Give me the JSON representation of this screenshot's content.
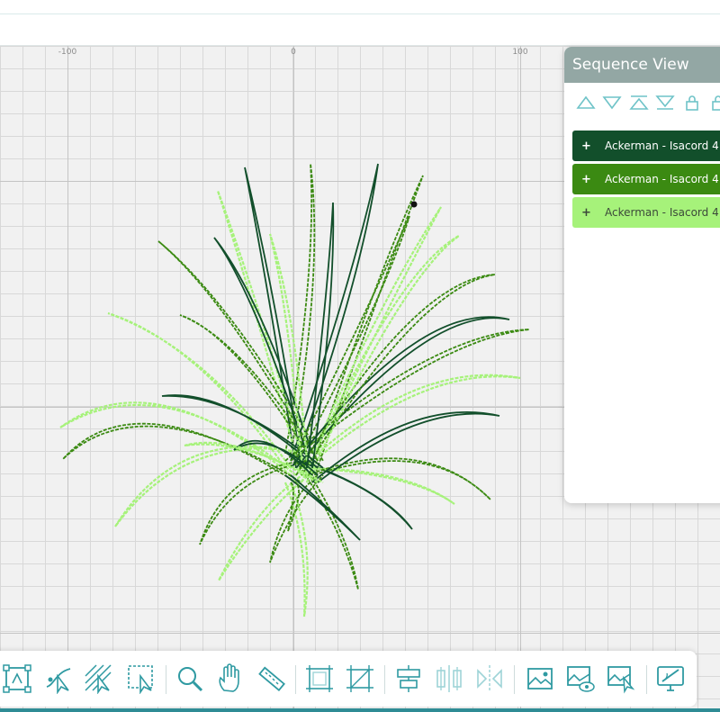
{
  "ruler": {
    "labels": [
      "-100",
      "0",
      "100"
    ]
  },
  "sequence_view": {
    "title": "Sequence View",
    "tools": [
      "move-up-icon",
      "move-down-icon",
      "move-to-top-icon",
      "move-to-bottom-icon",
      "lock-icon",
      "unlock-icon"
    ],
    "items": [
      {
        "plus": "+",
        "label": "Ackerman - Isacord 4",
        "color": "#124f2b"
      },
      {
        "plus": "+",
        "label": "Ackerman - Isacord 4",
        "color": "#3b8a12"
      },
      {
        "plus": "+",
        "label": "Ackerman - Isacord 4",
        "color": "#a6f27a"
      }
    ]
  },
  "toolbar": {
    "tools": [
      "transform-icon",
      "node-edit-icon",
      "stitch-direction-icon",
      "select-area-icon",
      "zoom-icon",
      "pan-icon",
      "measure-icon",
      "frame-icon",
      "crop-icon",
      "align-center-icon",
      "distribute-icon",
      "mirror-icon",
      "image-icon",
      "image-preview-icon",
      "image-select-icon",
      "embroidery-display-icon"
    ]
  },
  "colors": {
    "accent": "#2f9aa2",
    "panel_header": "#93a7a4",
    "dark_thread": "#124f2b",
    "mid_thread": "#3b8a12",
    "light_thread": "#a6f27a"
  }
}
